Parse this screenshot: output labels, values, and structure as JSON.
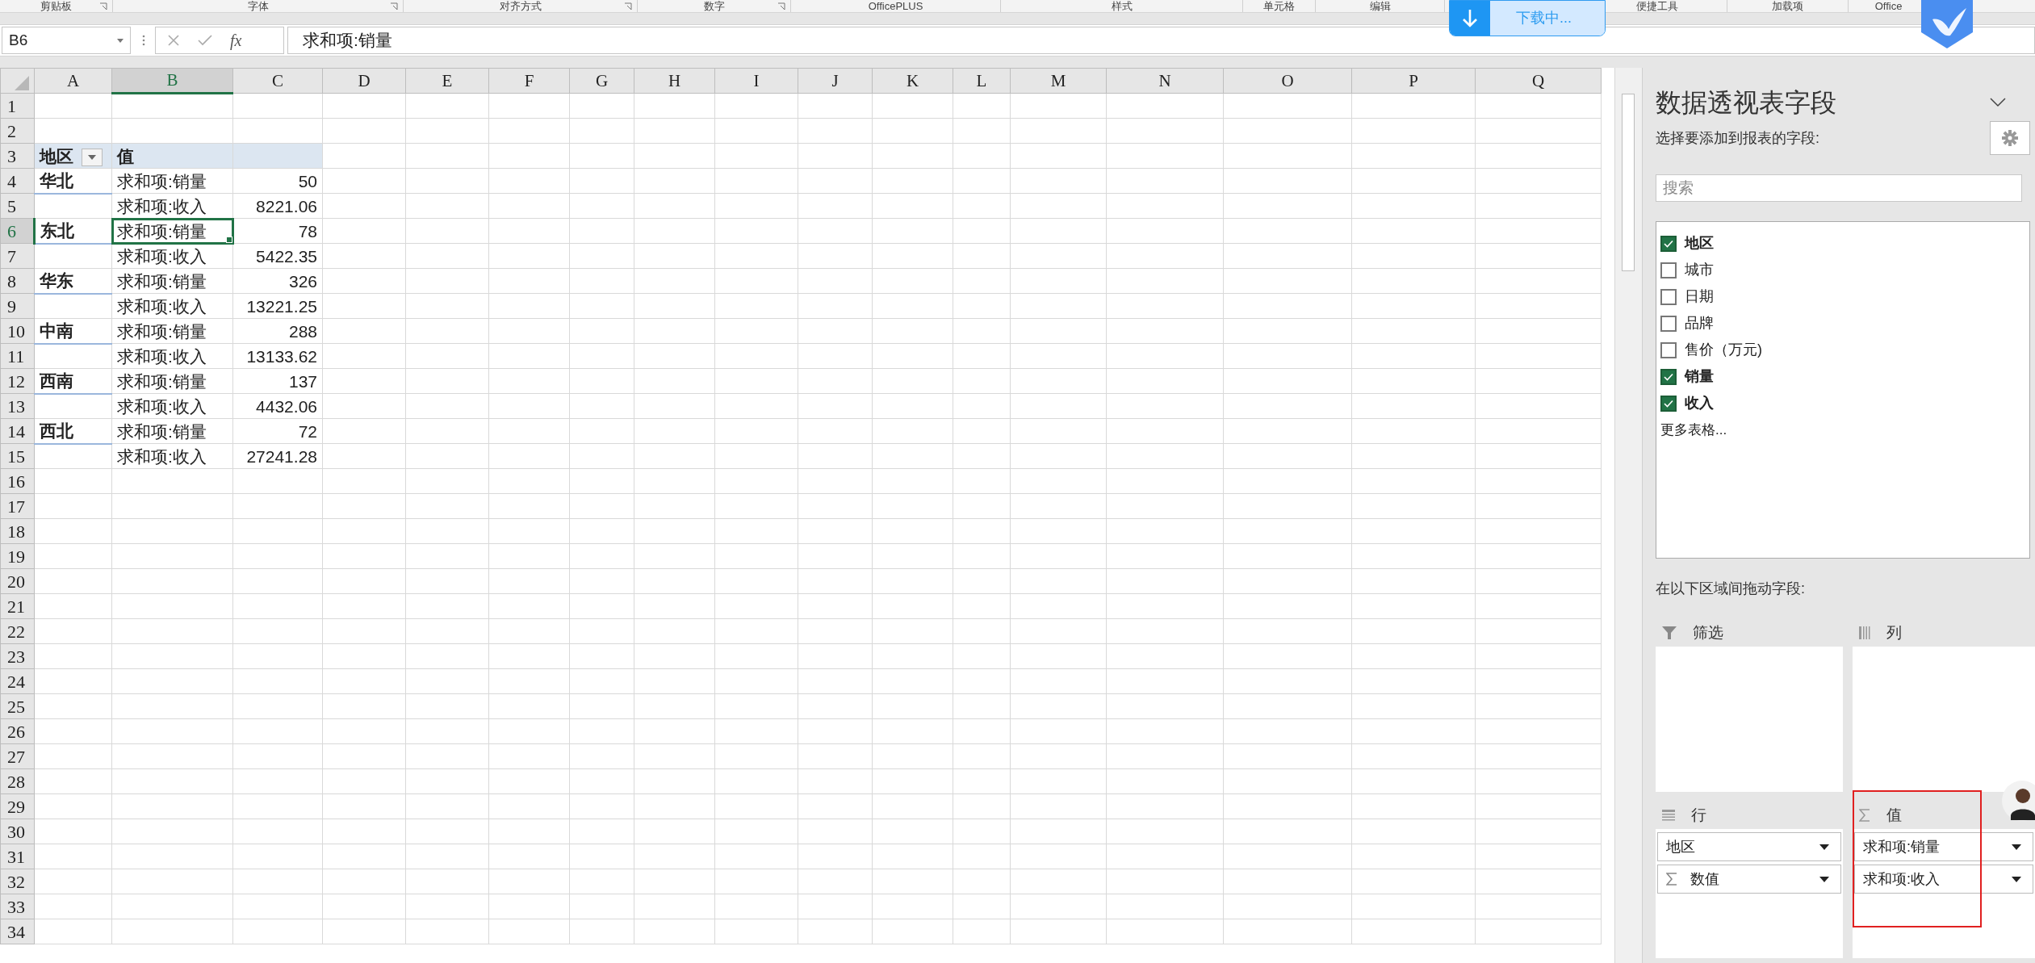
{
  "ribbon_groups": [
    {
      "label": "剪贴板",
      "launcher": true
    },
    {
      "label": "字体",
      "launcher": true
    },
    {
      "label": "对齐方式",
      "launcher": true
    },
    {
      "label": "数字",
      "launcher": true
    },
    {
      "label": "OfficePLUS",
      "launcher": false
    },
    {
      "label": "样式",
      "launcher": false
    },
    {
      "label": "单元格",
      "launcher": false
    },
    {
      "label": "编辑",
      "launcher": false
    },
    {
      "label": "便捷工具",
      "launcher": false
    },
    {
      "label": "加载项",
      "launcher": false
    },
    {
      "label": "Office",
      "launcher": false
    }
  ],
  "download_toast": {
    "text": "下载中..."
  },
  "formula_bar": {
    "name_box": "B6",
    "function_label": "fx",
    "formula": "求和项:销量"
  },
  "sheet": {
    "columns": [
      {
        "label": "A",
        "selected": false
      },
      {
        "label": "B",
        "selected": true
      },
      {
        "label": "C",
        "selected": false
      },
      {
        "label": "D",
        "selected": false
      },
      {
        "label": "E",
        "selected": false
      },
      {
        "label": "F",
        "selected": false
      },
      {
        "label": "G",
        "selected": false
      },
      {
        "label": "H",
        "selected": false
      },
      {
        "label": "I",
        "selected": false
      },
      {
        "label": "J",
        "selected": false
      },
      {
        "label": "K",
        "selected": false
      },
      {
        "label": "L",
        "selected": false
      },
      {
        "label": "M",
        "selected": false
      },
      {
        "label": "N",
        "selected": false
      },
      {
        "label": "O",
        "selected": false
      },
      {
        "label": "P",
        "selected": false
      },
      {
        "label": "Q",
        "selected": false
      }
    ],
    "rows": [
      {
        "label": "1",
        "selected": false
      },
      {
        "label": "2",
        "selected": false
      },
      {
        "label": "3",
        "selected": false,
        "kind": "pivot_header",
        "region": "地区",
        "field": "值"
      },
      {
        "label": "4",
        "selected": false,
        "kind": "data",
        "region": "华北",
        "field": "求和项:销量",
        "value": "50",
        "field_selected": false
      },
      {
        "label": "5",
        "selected": false,
        "kind": "data",
        "field": "求和项:收入",
        "value": "8221.06",
        "field_selected": false
      },
      {
        "label": "6",
        "selected": true,
        "kind": "data",
        "region": "东北",
        "field": "求和项:销量",
        "value": "78",
        "field_selected": true
      },
      {
        "label": "7",
        "selected": false,
        "kind": "data",
        "field": "求和项:收入",
        "value": "5422.35",
        "field_selected": false
      },
      {
        "label": "8",
        "selected": false,
        "kind": "data",
        "region": "华东",
        "field": "求和项:销量",
        "value": "326",
        "field_selected": false
      },
      {
        "label": "9",
        "selected": false,
        "kind": "data",
        "field": "求和项:收入",
        "value": "13221.25",
        "field_selected": false
      },
      {
        "label": "10",
        "selected": false,
        "kind": "data",
        "region": "中南",
        "field": "求和项:销量",
        "value": "288",
        "field_selected": false
      },
      {
        "label": "11",
        "selected": false,
        "kind": "data",
        "field": "求和项:收入",
        "value": "13133.62",
        "field_selected": false
      },
      {
        "label": "12",
        "selected": false,
        "kind": "data",
        "region": "西南",
        "field": "求和项:销量",
        "value": "137",
        "field_selected": false
      },
      {
        "label": "13",
        "selected": false,
        "kind": "data",
        "field": "求和项:收入",
        "value": "4432.06",
        "field_selected": false
      },
      {
        "label": "14",
        "selected": false,
        "kind": "data",
        "region": "西北",
        "field": "求和项:销量",
        "value": "72",
        "field_selected": false
      },
      {
        "label": "15",
        "selected": false,
        "kind": "data",
        "field": "求和项:收入",
        "value": "27241.28",
        "field_selected": false
      },
      {
        "label": "16",
        "selected": false
      },
      {
        "label": "17",
        "selected": false
      },
      {
        "label": "18",
        "selected": false
      },
      {
        "label": "19",
        "selected": false
      },
      {
        "label": "20",
        "selected": false
      },
      {
        "label": "21",
        "selected": false
      },
      {
        "label": "22",
        "selected": false
      },
      {
        "label": "23",
        "selected": false
      },
      {
        "label": "24",
        "selected": false
      },
      {
        "label": "25",
        "selected": false
      },
      {
        "label": "26",
        "selected": false
      },
      {
        "label": "27",
        "selected": false
      },
      {
        "label": "28",
        "selected": false
      },
      {
        "label": "29",
        "selected": false
      },
      {
        "label": "30",
        "selected": false
      },
      {
        "label": "31",
        "selected": false
      },
      {
        "label": "32",
        "selected": false
      },
      {
        "label": "33",
        "selected": false
      },
      {
        "label": "34",
        "selected": false
      }
    ]
  },
  "pivot_pane": {
    "title": "数据透视表字段",
    "subtitle": "选择要添加到报表的字段:",
    "search": {
      "placeholder": "搜索"
    },
    "fields": [
      {
        "label": "地区",
        "checked": true
      },
      {
        "label": "城市",
        "checked": false
      },
      {
        "label": "日期",
        "checked": false
      },
      {
        "label": "品牌",
        "checked": false
      },
      {
        "label": "售价（万元)",
        "checked": false
      },
      {
        "label": "销量",
        "checked": true
      },
      {
        "label": "收入",
        "checked": true
      }
    ],
    "more_tables": "更多表格...",
    "drag_hint": "在以下区域间拖动字段:",
    "areas": [
      {
        "kind": "filter",
        "title": "筛选"
      },
      {
        "kind": "columns",
        "title": "列"
      },
      {
        "kind": "rows",
        "title": "行",
        "items": [
          {
            "label": "地区",
            "kind": "field"
          },
          {
            "label": "数值",
            "kind": "values_field"
          }
        ]
      },
      {
        "kind": "values",
        "title": "值",
        "highlighted": true,
        "items": [
          {
            "label": "求和项:销量",
            "kind": "field"
          },
          {
            "label": "求和项:收入",
            "kind": "field"
          }
        ]
      }
    ]
  }
}
